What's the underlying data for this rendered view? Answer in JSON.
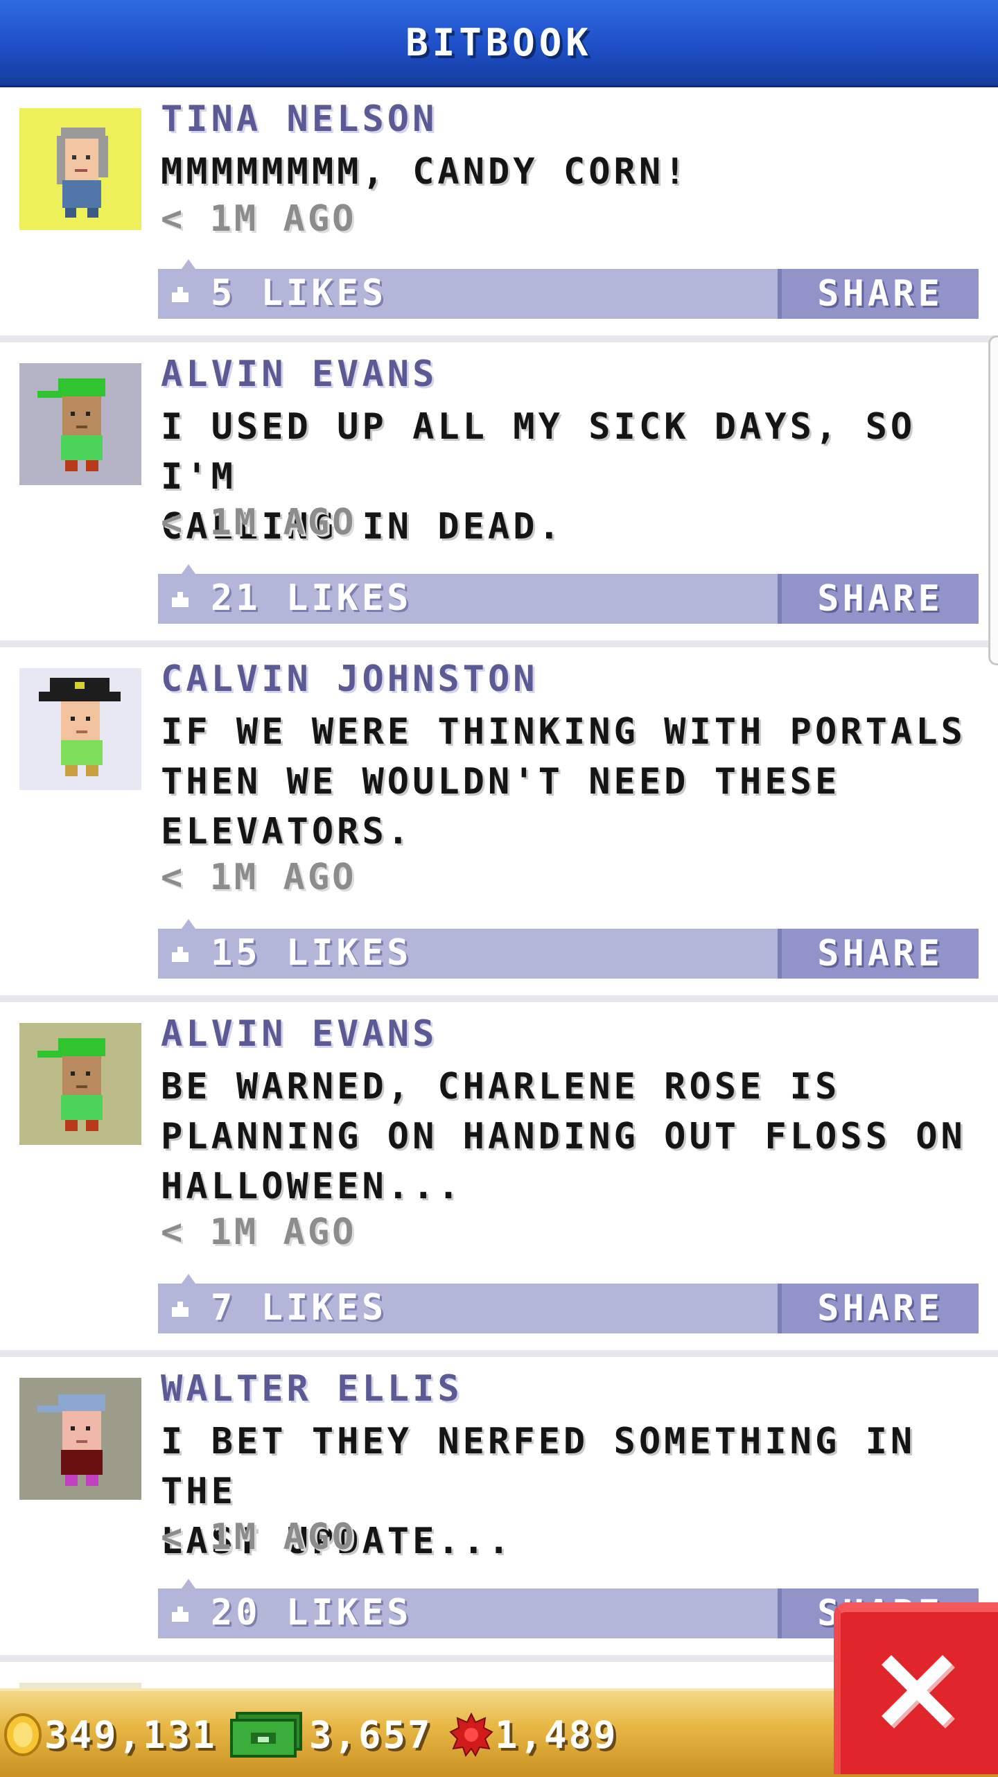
{
  "app": {
    "title": "BITBOOK"
  },
  "posts": [
    {
      "author": "TINA NELSON",
      "text": "MMMMMMMM, CANDY CORN!",
      "time": "< 1M AGO",
      "likes": "5 LIKES",
      "share_label": "SHARE",
      "avatar_bg": "#eef05a"
    },
    {
      "author": "ALVIN EVANS",
      "text": "I USED UP ALL MY SICK DAYS, SO I'M\nCALLING IN DEAD.",
      "time": "< 1M AGO",
      "likes": "21 LIKES",
      "share_label": "SHARE",
      "avatar_bg": "#b4b4c6"
    },
    {
      "author": "CALVIN JOHNSTON",
      "text": "IF WE WERE THINKING WITH PORTALS\nTHEN WE WOULDN'T NEED THESE\nELEVATORS.",
      "time": "< 1M AGO",
      "likes": "15 LIKES",
      "share_label": "SHARE",
      "avatar_bg": "#e8e8f4"
    },
    {
      "author": "ALVIN EVANS",
      "text": "BE WARNED, CHARLENE ROSE IS\nPLANNING ON HANDING OUT FLOSS ON\nHALLOWEEN...",
      "time": "< 1M AGO",
      "likes": "7 LIKES",
      "share_label": "SHARE",
      "avatar_bg": "#bcbc8a"
    },
    {
      "author": "WALTER ELLIS",
      "text": "I BET THEY NERFED SOMETHING IN THE\nLAST UPDATE...",
      "time": "< 1M AGO",
      "likes": "20 LIKES",
      "share_label": "SHARE",
      "avatar_bg": "#9c9c8a"
    }
  ],
  "currency": {
    "coins": "349,131",
    "bux": "3,657",
    "points": "1,489"
  },
  "colors": {
    "titlebar": "#1e4fc7",
    "likebar": "#b4b6d9",
    "share": "#9294c9",
    "bottombar": "#e8b845",
    "close": "#e0262b"
  },
  "icons": [
    "thumbs-up-icon",
    "coin-icon",
    "bux-icon",
    "points-icon",
    "close-icon"
  ]
}
